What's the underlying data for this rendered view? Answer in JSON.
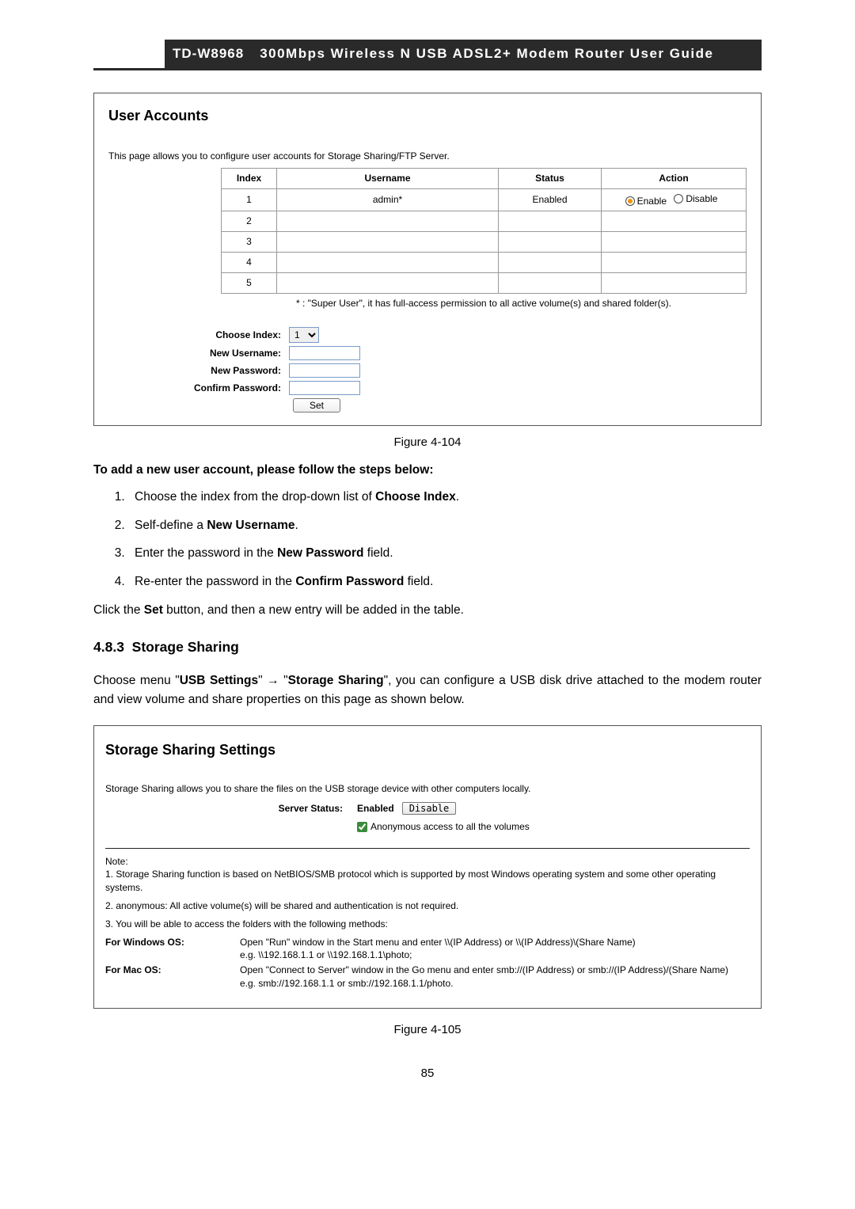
{
  "header": {
    "model": "TD-W8968",
    "title": "300Mbps Wireless N USB ADSL2+ Modem Router User Guide"
  },
  "panel1": {
    "heading": "User Accounts",
    "intro": "This page allows you to configure user accounts for Storage Sharing/FTP Server.",
    "cols": {
      "index": "Index",
      "username": "Username",
      "status": "Status",
      "action": "Action"
    },
    "rows": [
      {
        "index": "1",
        "username": "admin*",
        "status": "Enabled",
        "enable": "Enable",
        "disable": "Disable",
        "selected": "enable"
      },
      {
        "index": "2",
        "username": "",
        "status": "",
        "enable": "",
        "disable": ""
      },
      {
        "index": "3",
        "username": "",
        "status": "",
        "enable": "",
        "disable": ""
      },
      {
        "index": "4",
        "username": "",
        "status": "",
        "enable": "",
        "disable": ""
      },
      {
        "index": "5",
        "username": "",
        "status": "",
        "enable": "",
        "disable": ""
      }
    ],
    "footnote": "* : \"Super User\", it has full-access permission to all active volume(s) and shared folder(s).",
    "form": {
      "choose_index_label": "Choose Index:",
      "choose_index_value": "1",
      "new_username_label": "New Username:",
      "new_password_label": "New Password:",
      "confirm_password_label": "Confirm Password:",
      "set": "Set"
    }
  },
  "figcap1": "Figure 4-104",
  "instr_head": "To add a new user account, please follow the steps below:",
  "steps": {
    "s1a": "Choose the index from the drop-down list of ",
    "s1b": "Choose Index",
    "s1c": ".",
    "s2a": "Self-define a ",
    "s2b": "New Username",
    "s2c": ".",
    "s3a": "Enter the password in the ",
    "s3b": "New Password",
    "s3c": " field.",
    "s4a": "Re-enter the password in the ",
    "s4b": "Confirm Password",
    "s4c": " field."
  },
  "clickline_a": "Click the ",
  "clickline_b": "Set",
  "clickline_c": " button, and then a new entry will be added in the table.",
  "section_num": "4.8.3",
  "section_title": "Storage Sharing",
  "choose_para_a": "Choose menu \"",
  "choose_para_b": "USB Settings",
  "choose_para_arrow": "\" → \"",
  "choose_para_c": "Storage Sharing",
  "choose_para_d": "\", you can configure a USB disk drive attached to the modem router and view volume and share properties on this page as shown below.",
  "panel2": {
    "heading": "Storage Sharing Settings",
    "intro": "Storage Sharing allows you to share the files on the USB storage device with other computers locally.",
    "server_status_label": "Server Status:",
    "enabled": "Enabled",
    "disable": "Disable",
    "anon": "Anonymous access to all the volumes",
    "note_label": "Note:",
    "note1": "1. Storage Sharing function is based on NetBIOS/SMB protocol which is supported by most Windows operating system and some other operating systems.",
    "note2": "2. anonymous: All active volume(s) will be shared and authentication is not required.",
    "note3": "3. You will be able to access the folders with the following methods:",
    "win_label": "For Windows OS:",
    "win_line1": "Open \"Run\" window in the Start menu and enter \\\\(IP Address) or \\\\(IP Address)\\(Share Name)",
    "win_line2": "e.g. \\\\192.168.1.1 or \\\\192.168.1.1\\photo;",
    "mac_label": "For Mac OS:",
    "mac_line1": "Open \"Connect to Server\" window in the Go menu and enter smb://(IP Address) or smb://(IP Address)/(Share Name)",
    "mac_line2": "e.g. smb://192.168.1.1 or smb://192.168.1.1/photo."
  },
  "figcap2": "Figure 4-105",
  "pagenum": "85"
}
